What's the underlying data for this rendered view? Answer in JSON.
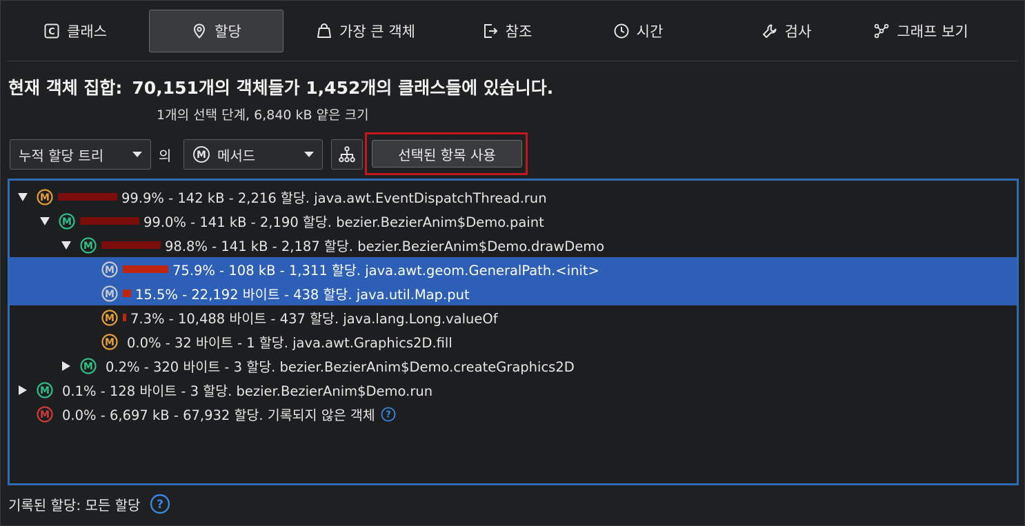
{
  "tabs": [
    {
      "label": "클래스",
      "icon": "class-icon",
      "active": false
    },
    {
      "label": "할당",
      "icon": "location-pin-icon",
      "active": true
    },
    {
      "label": "가장 큰 객체",
      "icon": "weight-bag-icon",
      "active": false
    },
    {
      "label": "참조",
      "icon": "exit-arrow-icon",
      "active": false
    },
    {
      "label": "시간",
      "icon": "clock-icon",
      "active": false
    },
    {
      "label": "검사",
      "icon": "wrench-icon",
      "active": false
    },
    {
      "label": "그래프 보기",
      "icon": "graph-nodes-icon",
      "active": false
    }
  ],
  "heading": {
    "label": "현재 객체 집합:",
    "summary": "70,151개의 객체들가 1,452개의 클래스들에 있습니다."
  },
  "subline": "1개의 선택 단계, 6,840 kB 얕은 크기",
  "controls": {
    "view_select": "누적 할당 트리",
    "of_label": "의",
    "aggregation_select": "메서드",
    "use_selected_button": "선택된 항목 사용"
  },
  "colors": {
    "accent_blue": "#2d5fb6",
    "tree_border": "#2f6bb5",
    "highlight_red": "#c4161c",
    "method_orange": "#e8a13a",
    "method_green": "#2fbf87",
    "method_red": "#d23a3a",
    "method_gray": "#c8ccd2",
    "bar_dark": "#7a0c0c",
    "bar_bright": "#c0260f"
  },
  "tree_rows": [
    {
      "text": "99.9% - 142 kB - 2,216 할당. java.awt.EventDispatchThread.run",
      "percent": 99.9,
      "icon": "orange",
      "expander": "open",
      "selected": false
    },
    {
      "text": "99.0% - 141 kB - 2,190 할당. bezier.BezierAnim$Demo.paint",
      "percent": 99.0,
      "icon": "green",
      "expander": "open",
      "selected": false
    },
    {
      "text": "98.8% - 141 kB - 2,187 할당. bezier.BezierAnim$Demo.drawDemo",
      "percent": 98.8,
      "icon": "green",
      "expander": "open",
      "selected": false
    },
    {
      "text": "75.9% - 108 kB - 1,311 할당. java.awt.geom.GeneralPath.<init>",
      "percent": 75.9,
      "icon": "gray",
      "expander": "none",
      "selected": true
    },
    {
      "text": "15.5% - 22,192 바이트 - 438 할당. java.util.Map.put",
      "percent": 15.5,
      "icon": "gray",
      "expander": "none",
      "selected": true
    },
    {
      "text": "7.3% - 10,488 바이트 - 437 할당. java.lang.Long.valueOf",
      "percent": 7.3,
      "icon": "orange",
      "expander": "none",
      "selected": false
    },
    {
      "text": "0.0% - 32 바이트 - 1 할당. java.awt.Graphics2D.fill",
      "percent": 0.0,
      "icon": "orange",
      "expander": "none",
      "selected": false
    },
    {
      "text": "0.2% - 320 바이트 - 3 할당. bezier.BezierAnim$Demo.createGraphics2D",
      "percent": 0.2,
      "icon": "green",
      "expander": "closed",
      "selected": false
    },
    {
      "text": "0.1% - 128 바이트 - 3 할당. bezier.BezierAnim$Demo.run",
      "percent": 0.1,
      "icon": "green",
      "expander": "closed",
      "selected": false
    },
    {
      "text": "0.0% - 6,697 kB - 67,932 할당. 기록되지 않은 객체",
      "percent": 0.0,
      "icon": "red",
      "expander": "none",
      "selected": false,
      "help": true
    }
  ],
  "footer": {
    "label": "기록된 할당: 모든 할당"
  }
}
